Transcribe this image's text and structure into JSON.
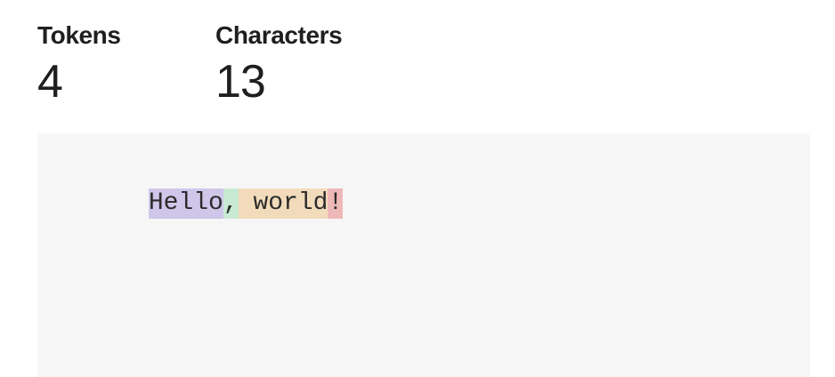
{
  "stats": {
    "tokens": {
      "label": "Tokens",
      "value": "4"
    },
    "characters": {
      "label": "Characters",
      "value": "13"
    }
  },
  "token_view": {
    "tokens": [
      {
        "text": "Hello",
        "color": "#cfc6ea"
      },
      {
        "text": ",",
        "color": "#c8ead2"
      },
      {
        "text": " world",
        "color": "#f2dbbb"
      },
      {
        "text": "!",
        "color": "#efb8b8"
      }
    ]
  }
}
